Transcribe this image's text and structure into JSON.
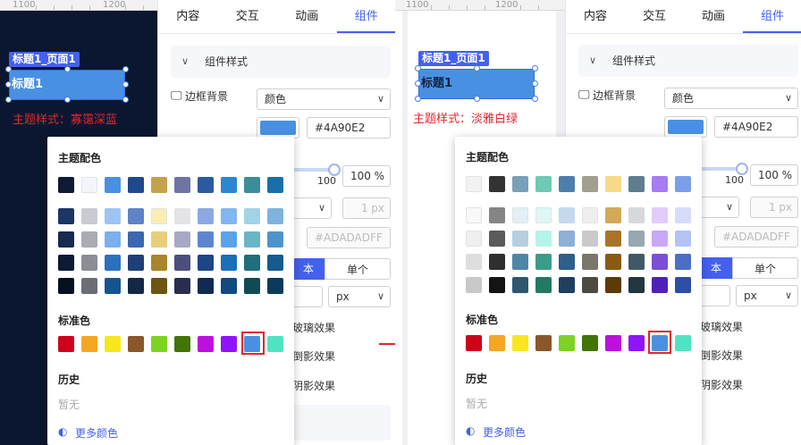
{
  "ruler": {
    "mark1": "1100",
    "mark2": "1200"
  },
  "tabs": [
    "内容",
    "交互",
    "动画",
    "组件"
  ],
  "section": "组件样式",
  "border_bg_label": "边框背景",
  "fill_type": "颜色",
  "hex_value": "#4A90E2",
  "opacity": {
    "value": "100",
    "unit": "%",
    "tick": "100"
  },
  "border_width": {
    "value": "1",
    "unit": "px"
  },
  "border_color": "#ADADADFF",
  "border_mode": {
    "all": "本",
    "single": "单个"
  },
  "radius_unit": "px",
  "effects": [
    "玻璃效果",
    "倒影效果",
    "阴影效果"
  ],
  "left_canvas": {
    "tag": "标题1_页面1",
    "component_text": "标题1",
    "theme_note": "主题样式：寡霭深蓝"
  },
  "right_canvas": {
    "tag": "标题1_页面1",
    "component_text": "标题1",
    "theme_note": "主题样式：淡雅白绿"
  },
  "popup": {
    "theme_title": "主题配色",
    "standard_title": "标准色",
    "history_title": "历史",
    "history_empty": "暂无",
    "more_colors": "更多颜色"
  },
  "colors": {
    "accent": "#4361ee",
    "selected": "#4A90E2",
    "left_theme_top": [
      "#0f1b34",
      "#f2f6fc",
      "#4a90e2",
      "#1f4a8a",
      "#c4a24d",
      "#6e74a3",
      "#2b5aa0",
      "#2e86d0",
      "#3a8e9a",
      "#1a6fa8"
    ],
    "left_theme_rows": [
      [
        "#1b3565",
        "#c8cbd1",
        "#9ec4f4",
        "#5f83c6",
        "#fbeeb3",
        "#e3e3e8",
        "#8ca9e4",
        "#82b6f0",
        "#a1d3e6",
        "#7fb3dd"
      ],
      [
        "#162a52",
        "#a9acb3",
        "#7aaeee",
        "#3d66b2",
        "#e6cf7b",
        "#a7a9c3",
        "#5e86cf",
        "#59a3ea",
        "#6ab4c8",
        "#4d94cc"
      ],
      [
        "#0c1a36",
        "#8b8e95",
        "#2b71bf",
        "#1f3f78",
        "#a9852b",
        "#4b4f7d",
        "#1c4685",
        "#1b6fba",
        "#1f6f7d",
        "#145b8f"
      ],
      [
        "#07101f",
        "#6b6e74",
        "#15558f",
        "#132747",
        "#6f5512",
        "#2a2d50",
        "#0f2b53",
        "#0f4b7f",
        "#0f4b55",
        "#0b3a5c"
      ]
    ],
    "right_theme_top": [
      "#f3f3f3",
      "#333333",
      "#7aa0b8",
      "#6fc9b4",
      "#4c7fab",
      "#a19f8f",
      "#f9d98a",
      "#5d7e8e",
      "#a77bf2",
      "#7b9ee9"
    ],
    "right_theme_rows": [
      [
        "#f8f8f8",
        "#858585",
        "#e3eef5",
        "#dcf7f6",
        "#c4d8f0",
        "#eeeeee",
        "#d3a958",
        "#d5d9dc",
        "#e2ccfb",
        "#d5ddfa"
      ],
      [
        "#efefef",
        "#5b5b5b",
        "#b6cfe0",
        "#b6f3ea",
        "#8eafd8",
        "#cacaca",
        "#a87528",
        "#98a8b0",
        "#c8a8f8",
        "#b3c4f4"
      ],
      [
        "#dedede",
        "#2f2f2f",
        "#4e86a6",
        "#3b9c87",
        "#2f5f8c",
        "#7a766a",
        "#8b5a12",
        "#3f5a66",
        "#7b4fd6",
        "#4b6fc7"
      ],
      [
        "#c9c9c9",
        "#141414",
        "#2b5770",
        "#227a64",
        "#1f3f5f",
        "#4d4a41",
        "#5e3a06",
        "#213740",
        "#4f21b6",
        "#2d4ea3"
      ]
    ],
    "standard": [
      "#d0021b",
      "#f5a623",
      "#f8e71c",
      "#8b572a",
      "#7ed321",
      "#417505",
      "#bd10e0",
      "#9013fe",
      "#4a90e2",
      "#50e3c2"
    ]
  },
  "arrow_icon": "right-arrow-icon"
}
